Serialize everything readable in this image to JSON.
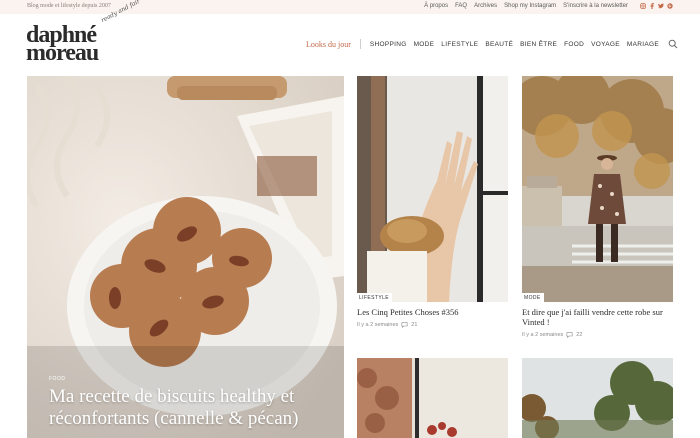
{
  "topbar": {
    "tagline": "Blog mode et lifestyle depuis 2007",
    "links": [
      "À propos",
      "FAQ",
      "Archives",
      "Shop my Instagram",
      "S'inscrire à la newsletter"
    ],
    "social_icons": [
      "instagram-icon",
      "facebook-icon",
      "twitter-icon",
      "pinterest-icon"
    ]
  },
  "logo": {
    "line1": "daphné",
    "line2": "moreau",
    "script": "ready and fair"
  },
  "nav": {
    "highlight": "Looks du jour",
    "items": [
      "SHOPPING",
      "MODE",
      "LIFESTYLE",
      "BEAUTÉ",
      "BIEN ÊTRE",
      "FOOD",
      "VOYAGE",
      "MARIAGE"
    ]
  },
  "hero": {
    "category": "FOOD",
    "title": "Ma recette de biscuits healthy et réconfortants (cannelle & pécan)"
  },
  "posts": [
    {
      "category": "LIFESTYLE",
      "title": "Les Cinq Petites Choses #356",
      "time": "Il y a 2 semaines",
      "comments": "21"
    },
    {
      "category": "MODE",
      "title": "Et dire que j'ai failli vendre cette robe sur Vinted !",
      "time": "Il y a 2 semaines",
      "comments": "22"
    }
  ],
  "colors": {
    "accent": "#c46a4a",
    "topbar_bg": "#faf3ef",
    "text": "#2b2b2b"
  }
}
